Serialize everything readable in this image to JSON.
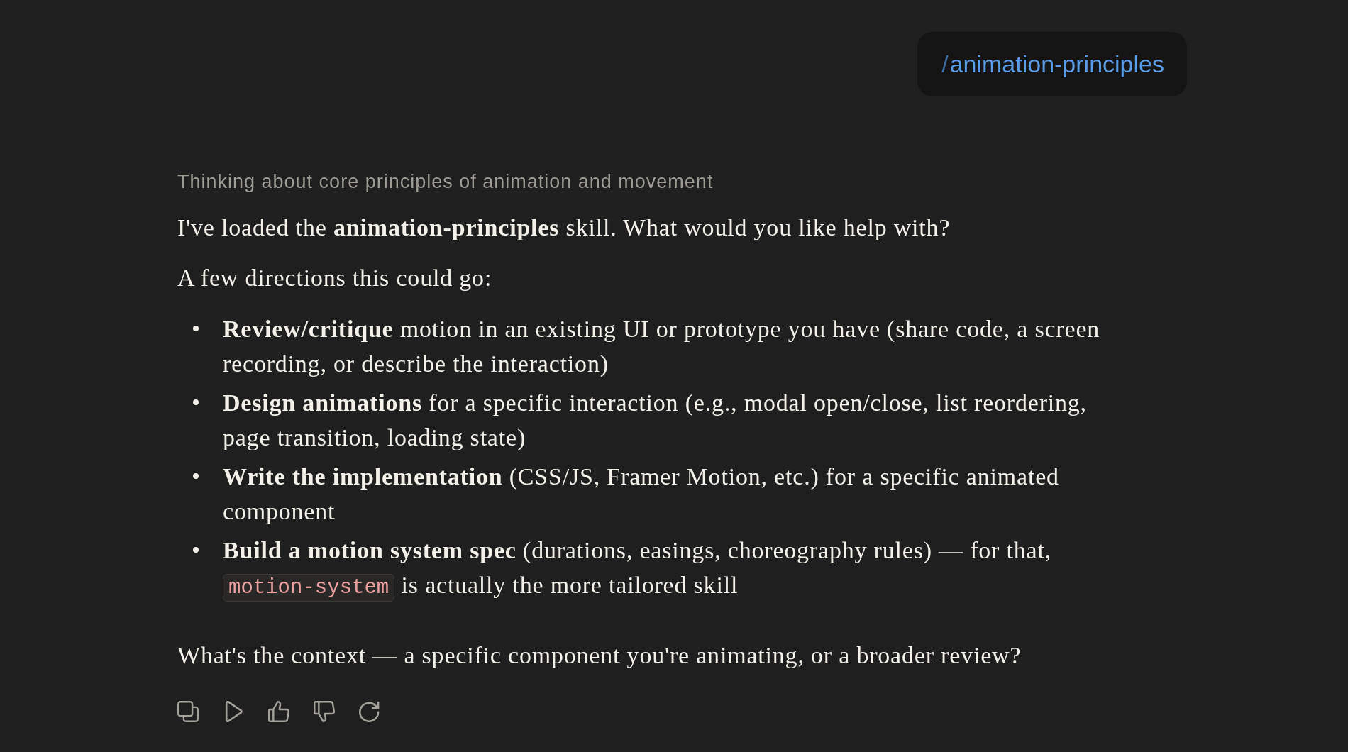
{
  "user_message": {
    "prefix": "/",
    "command": "animation-principles"
  },
  "response": {
    "thinking": "Thinking about core principles of animation and movement",
    "paragraphs": [
      "I've loaded the **animation-principles** skill. What would you like help with?",
      "A few directions this could go:"
    ],
    "bullets": [
      {
        "parts": [
          {
            "kind": "text",
            "text": "**Review/critique** motion in an existing UI or prototype you have (share code, a screen recording, or describe the interaction)"
          }
        ]
      },
      {
        "parts": [
          {
            "kind": "text",
            "text": "**Design animations** for a specific interaction (e.g., modal open/close, list reordering, page transition, loading state)"
          }
        ]
      },
      {
        "parts": [
          {
            "kind": "text",
            "text": "**Write the implementation** (CSS/JS, Framer Motion, etc.) for a specific animated component"
          }
        ]
      },
      {
        "parts": [
          {
            "kind": "text",
            "text": "**Build a motion system spec** (durations, easings, choreography rules) — for that,"
          },
          {
            "kind": "code",
            "text": "motion-system"
          },
          {
            "kind": "text",
            "text": "is actually the more tailored skill"
          }
        ]
      }
    ],
    "closing": "What's the context — a specific component you're animating, or a broader review?"
  },
  "actions": [
    {
      "kind": "copy"
    },
    {
      "kind": "speak"
    },
    {
      "kind": "like"
    },
    {
      "kind": "dislike"
    },
    {
      "kind": "retry"
    }
  ]
}
